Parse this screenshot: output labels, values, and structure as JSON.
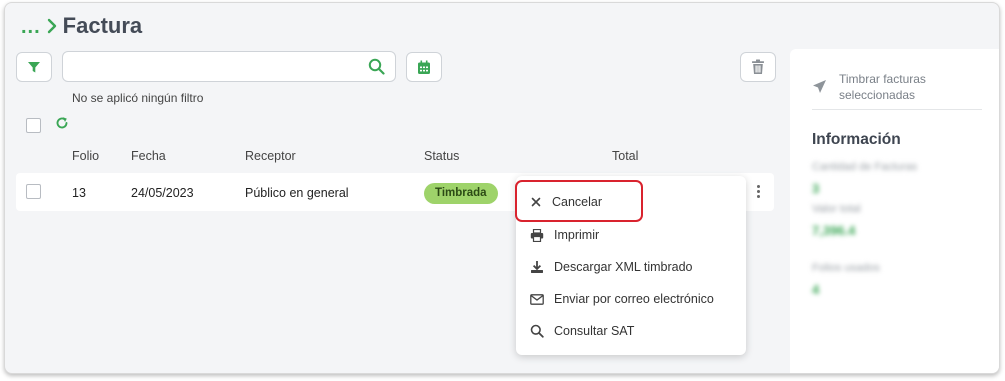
{
  "breadcrumb": {
    "ellipsis": "...",
    "title": "Factura"
  },
  "search": {
    "value": "",
    "placeholder": ""
  },
  "filter_status": "No se aplicó ningún filtro",
  "table": {
    "headers": [
      "Folio",
      "Fecha",
      "Receptor",
      "Status",
      "Total"
    ],
    "rows": [
      {
        "folio": "13",
        "fecha": "24/05/2023",
        "receptor": "Público en general",
        "status": "Timbrada",
        "total": ""
      }
    ]
  },
  "context_menu": {
    "items": [
      {
        "label": "Cancelar",
        "icon": "close-icon"
      },
      {
        "label": "Imprimir",
        "icon": "printer-icon"
      },
      {
        "label": "Descargar XML timbrado",
        "icon": "download-icon"
      },
      {
        "label": "Enviar por correo electrónico",
        "icon": "envelope-icon"
      },
      {
        "label": "Consultar SAT",
        "icon": "search-icon"
      }
    ]
  },
  "side_panel": {
    "timbrar_label": "Timbrar facturas seleccionadas",
    "info_title": "Información",
    "cantidad_label": "Cantidad de Facturas",
    "cantidad_value": "3",
    "valor_label": "Valor total",
    "valor_value": "7,396.4",
    "folios_label": "Folios usados",
    "folios_value": "4"
  },
  "colors": {
    "accent_green": "#3aa655",
    "badge_green": "#9ed36a",
    "highlight_red": "#d9232e",
    "background": "#f4f5f7"
  }
}
